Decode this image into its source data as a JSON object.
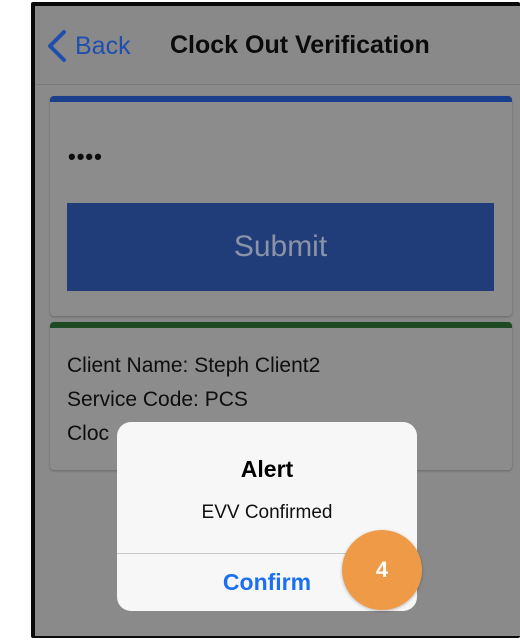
{
  "nav": {
    "back_label": "Back",
    "title": "Clock Out Verification"
  },
  "pin_card": {
    "masked_value": "••••",
    "submit_label": "Submit"
  },
  "info_card": {
    "lines": [
      "Client Name: Steph Client2",
      "Service Code: PCS",
      "Cloc"
    ]
  },
  "alert": {
    "title": "Alert",
    "message": "EVV Confirmed",
    "confirm_label": "Confirm"
  },
  "step_badge": {
    "number": "4"
  },
  "colors": {
    "accent_blue": "#1b6ff2",
    "pin_card_stripe": "#1a3f8c",
    "info_card_stripe": "#1d4a22",
    "submit_button": "#213d79",
    "step_badge": "#ef9a46"
  },
  "icons": {
    "back": "chevron-left-icon"
  }
}
